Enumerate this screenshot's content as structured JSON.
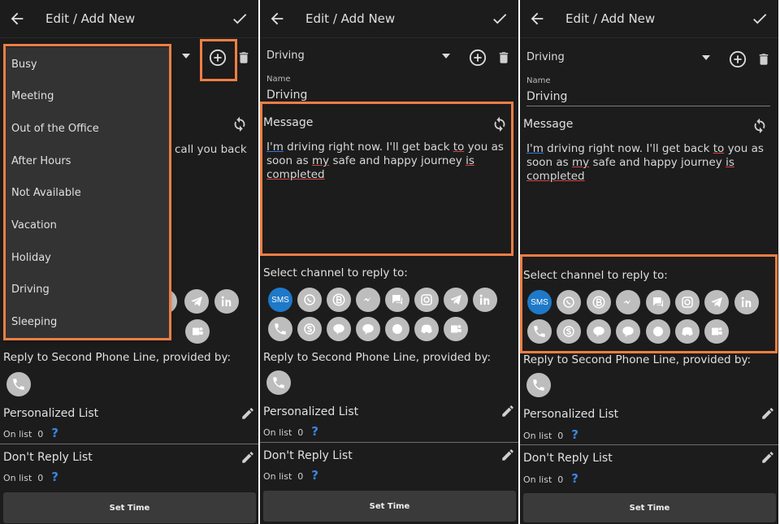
{
  "header": {
    "title": "Edit / Add New"
  },
  "profile": {
    "selected": "Driving",
    "name_label": "Name",
    "name_value": "Driving"
  },
  "message": {
    "label": "Message",
    "panel1_visible": "call you back",
    "words": [
      "I'm",
      "driving right now. I'll get back",
      "to",
      "you as soon as",
      "my",
      "safe and happy journey",
      "is",
      "completed"
    ]
  },
  "channels": {
    "label": "Select channel to reply to:",
    "row1": [
      "sms-icon",
      "whatsapp-icon",
      "business-icon",
      "messenger-icon",
      "chat-icon",
      "instagram-icon",
      "telegram-icon",
      "linkedin-icon"
    ],
    "row2": [
      "phone-icon",
      "skype-icon",
      "line-icon",
      "talk-icon",
      "signal-icon",
      "discord-icon",
      "teams-icon"
    ],
    "sms_label": "SMS"
  },
  "second_line": {
    "label": "Reply to Second Phone Line, provided by:",
    "icon": "phone-icon"
  },
  "personalized": {
    "title": "Personalized List",
    "on_list": "On list",
    "count": "0",
    "help": "?"
  },
  "dont_reply": {
    "title": "Don't Reply List",
    "on_list": "On list",
    "count": "0",
    "help": "?"
  },
  "set_time": {
    "label": "Set Time"
  },
  "menu": {
    "items": [
      "Busy",
      "Meeting",
      "Out of the Office",
      "After Hours",
      "Not Available",
      "Vacation",
      "Holiday",
      "Driving",
      "Sleeping"
    ]
  },
  "colors": {
    "background": "#1c1c1c",
    "highlight": "#f07e44",
    "sms": "#1e79c8",
    "help": "#3a86e0"
  }
}
